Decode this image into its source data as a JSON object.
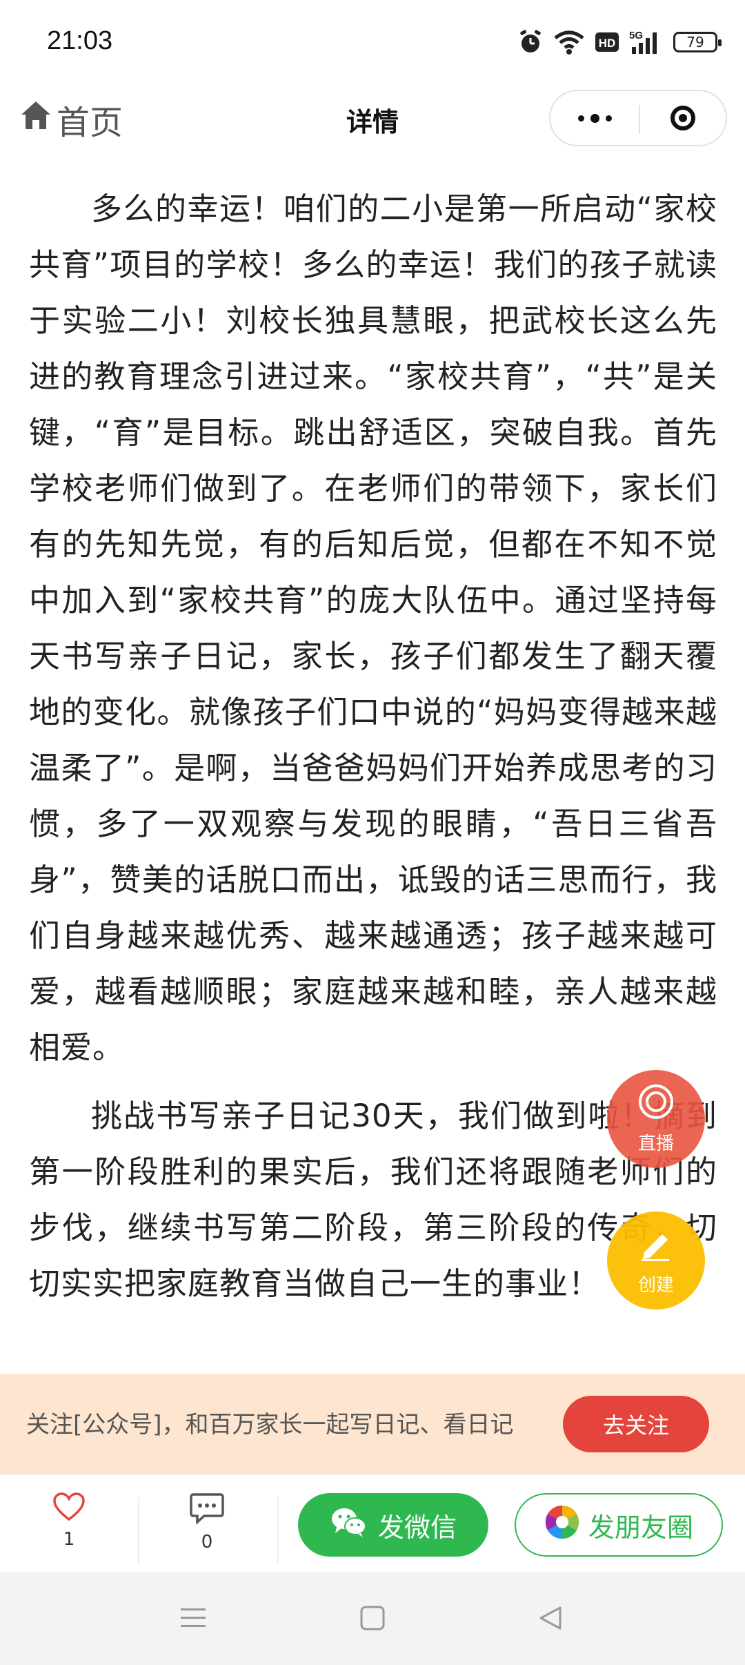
{
  "status_bar": {
    "time": "21:03",
    "icons": [
      "alarm-icon",
      "wifi-icon",
      "hd-icon",
      "5g-signal-icon",
      "battery-icon"
    ],
    "hd_label": "HD",
    "network_label": "5G",
    "battery_level": "79"
  },
  "nav": {
    "home_label": "首页",
    "title": "详情"
  },
  "article": {
    "paragraphs": [
      "多么的幸运！咱们的二小是第一所启动“家校共育”项目的学校！多么的幸运！我们的孩子就读于实验二小！刘校长独具慧眼，把武校长这么先进的教育理念引进过来。“家校共育”，“共”是关键，“育”是目标。跳出舒适区，突破自我。首先学校老师们做到了。在老师们的带领下，家长们有的先知先觉，有的后知后觉，但都在不知不觉中加入到“家校共育”的庞大队伍中。通过坚持每天书写亲子日记，家长，孩子们都发生了翻天覆地的变化。就像孩子们口中说的“妈妈变得越来越温柔了”。是啊，当爸爸妈妈们开始养成思考的习惯，多了一双观察与发现的眼睛，“吾日三省吾身”，赞美的话脱口而出，诋毁的话三思而行，我们自身越来越优秀、越来越通透；孩子越来越可爱，越看越顺眼；家庭越来越和睦，亲人越来越相爱。",
      "挑战书写亲子日记30天，我们做到啦！摘到第一阶段胜利的果实后，我们还将跟随老师们的步伐，继续书写第二阶段，第三阶段的传奇，切切实实把家庭教育当做自己一生的事业！"
    ]
  },
  "fab": {
    "live_label": "直播",
    "create_label": "创建"
  },
  "follow_banner": {
    "text": "关注[公众号]，和百万家长一起写日记、看日记",
    "button_label": "去关注"
  },
  "actions": {
    "like_count": "1",
    "comment_count": "0",
    "wechat_label": "发微信",
    "moments_label": "发朋友圈"
  },
  "colors": {
    "accent_green": "#2fb84f",
    "follow_red": "#e5443c",
    "live_red": "#e85540",
    "create_yellow": "#fbbe00",
    "banner_bg": "#fde5d0"
  }
}
